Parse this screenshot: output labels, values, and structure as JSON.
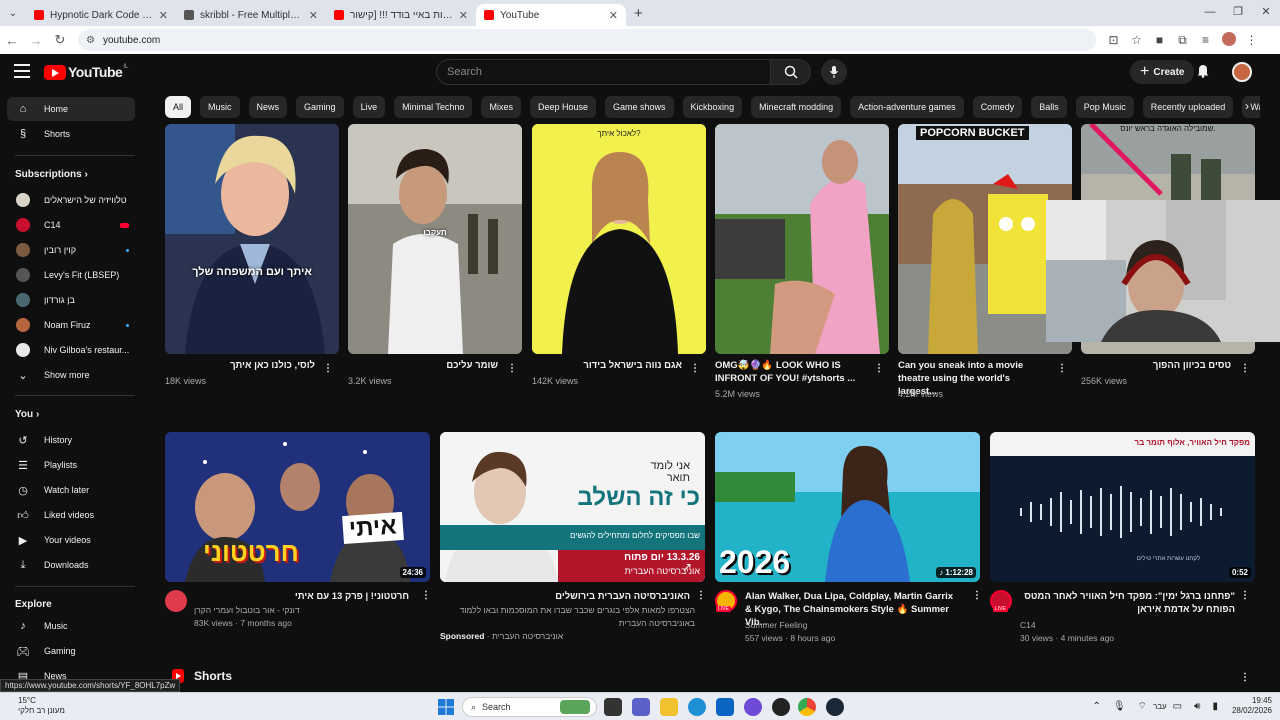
{
  "browser": {
    "tabs": [
      {
        "title": "Hypnotic Dark Code | Futuristic",
        "favicon_color": "#ff0000",
        "active": false
      },
      {
        "title": "skribbl - Free Multiplayer Draw",
        "favicon_color": "#555555",
        "active": false
      },
      {
        "title": "שידור 24 שעות באיי בודד !!! [קישור",
        "favicon_color": "#ff0000",
        "active": false
      },
      {
        "title": "YouTube",
        "favicon_color": "#ff0000",
        "active": true
      }
    ],
    "url": "youtube.com"
  },
  "header": {
    "logo_text": "YouTube",
    "country_code": "IL",
    "search_placeholder": "Search",
    "create_label": "Create"
  },
  "chips": [
    "All",
    "Music",
    "News",
    "Gaming",
    "Live",
    "Minimal Techno",
    "Mixes",
    "Deep House",
    "Game shows",
    "Kickboxing",
    "Minecraft modding",
    "Action-adventure games",
    "Comedy",
    "Balls",
    "Pop Music",
    "Recently uploaded",
    "Watched"
  ],
  "sidebar": {
    "home": "Home",
    "shorts": "Shorts",
    "subscriptions_head": "Subscriptions",
    "subscriptions": [
      {
        "name": "טלוויזיה של הישראלים",
        "color": "#d9d4c7",
        "live": false
      },
      {
        "name": "C14",
        "color": "#c8102e",
        "live": true
      },
      {
        "name": "קוין רובין",
        "color": "#7a5a40",
        "live": true
      },
      {
        "name": "Levy's Fit (LBSEP)",
        "color": "#555555",
        "live": false
      },
      {
        "name": "בן גורדון",
        "color": "#4a6670",
        "live": false
      },
      {
        "name": "Noam Firuz",
        "color": "#b7653f",
        "live": true
      },
      {
        "name": "Niv Gilboa's restaur...",
        "color": "#e8e8e8",
        "live": false
      }
    ],
    "show_more": "Show more",
    "you_head": "You",
    "you_items": [
      "History",
      "Playlists",
      "Watch later",
      "Liked videos",
      "Your videos",
      "Downloads"
    ],
    "explore_head": "Explore",
    "explore_items": [
      "Music",
      "Gaming",
      "News"
    ]
  },
  "shorts_row": [
    {
      "title": "לוסי, כולנו כאן איתך",
      "views": "18K views",
      "caption": "איתך ועם המשפחה שלך"
    },
    {
      "title": "שומר עליכם",
      "views": "3.2K views",
      "caption": "תעקבו"
    },
    {
      "title": "אגם נווה בישראל בידור",
      "views": "142K views",
      "caption": "לאכול איתך?"
    },
    {
      "title": "OMG🤯🔮🔥 LOOK WHO IS INFRONT OF YOU! #ytshorts ...",
      "views": "5.2M views",
      "caption": ""
    },
    {
      "title": "Can you sneak into a movie theatre using the world's largest...",
      "views": "4.2M views",
      "caption": "POPCORN BUCKET"
    },
    {
      "title": "טסים בכיוון ההפוך",
      "views": "256K views",
      "caption": "שמובילה האוגדה בראש יונס."
    }
  ],
  "videos": [
    {
      "title": "חרטטוני! | פרק 13 עם איתי",
      "channel": "דונקי - אור בוטבול ועמרי הקרן",
      "meta": "83K views · 7 months ago",
      "duration": "24:36",
      "thumb_text": "חרטטוני",
      "thumb_badge": "איתי"
    },
    {
      "title": "האוניברסיטה העברית בירושלים",
      "channel": "הצטרפו למאות אלפי בוגרים שכבר שברו את המוסכמות ובאו ללמוד באוניברסיטה העברית",
      "meta": "אוניברסיטה העברית",
      "sponsored": "Sponsored",
      "duration": "",
      "ad_line1": "אני לומד",
      "ad_line2": "תואר",
      "ad_headline": "כי זה השלב",
      "ad_sub": "שבו מפסיקים לחלום ומתחילים להגשים",
      "ad_date": "13.3.26 יום פתוח",
      "ad_uni": "אוניברסיטה העברית"
    },
    {
      "title": "Alan Walker, Dua Lipa, Coldplay, Martin Garrix & Kygo, The Chainsmokers Style 🔥 Summer Vib...",
      "channel": "Summer Feeling",
      "meta": "557 views · 8 hours ago",
      "duration": "1:12:28",
      "thumb_text": "2026",
      "live_badge": "LIVE"
    },
    {
      "title": "\"פתחנו ברגל ימין\": מפקד חיל האוויר לאחר המטס הפותח על אדמת איראן",
      "channel": "C14",
      "meta": "30 views · 4 minutes ago",
      "duration": "0:52",
      "thumb_text": "מפקד חיל האוויר, אלוף תומר בר",
      "thumb_sub": "לקחנו עשרות אתרי טילים",
      "live_badge": "LIVE"
    }
  ],
  "shorts_heading": "Shorts",
  "status_url": "https://www.youtube.com/shorts/YF_8OHL7pZw",
  "taskbar": {
    "temp": "15°C",
    "weather_text": "מעונן רב חלקי",
    "search_label": "Search",
    "lang": "עבר",
    "time": "19:45",
    "date": "28/02/2026"
  },
  "colors": {
    "yt_red": "#ff0000",
    "bg": "#0f0f0f",
    "chip": "#272727"
  }
}
